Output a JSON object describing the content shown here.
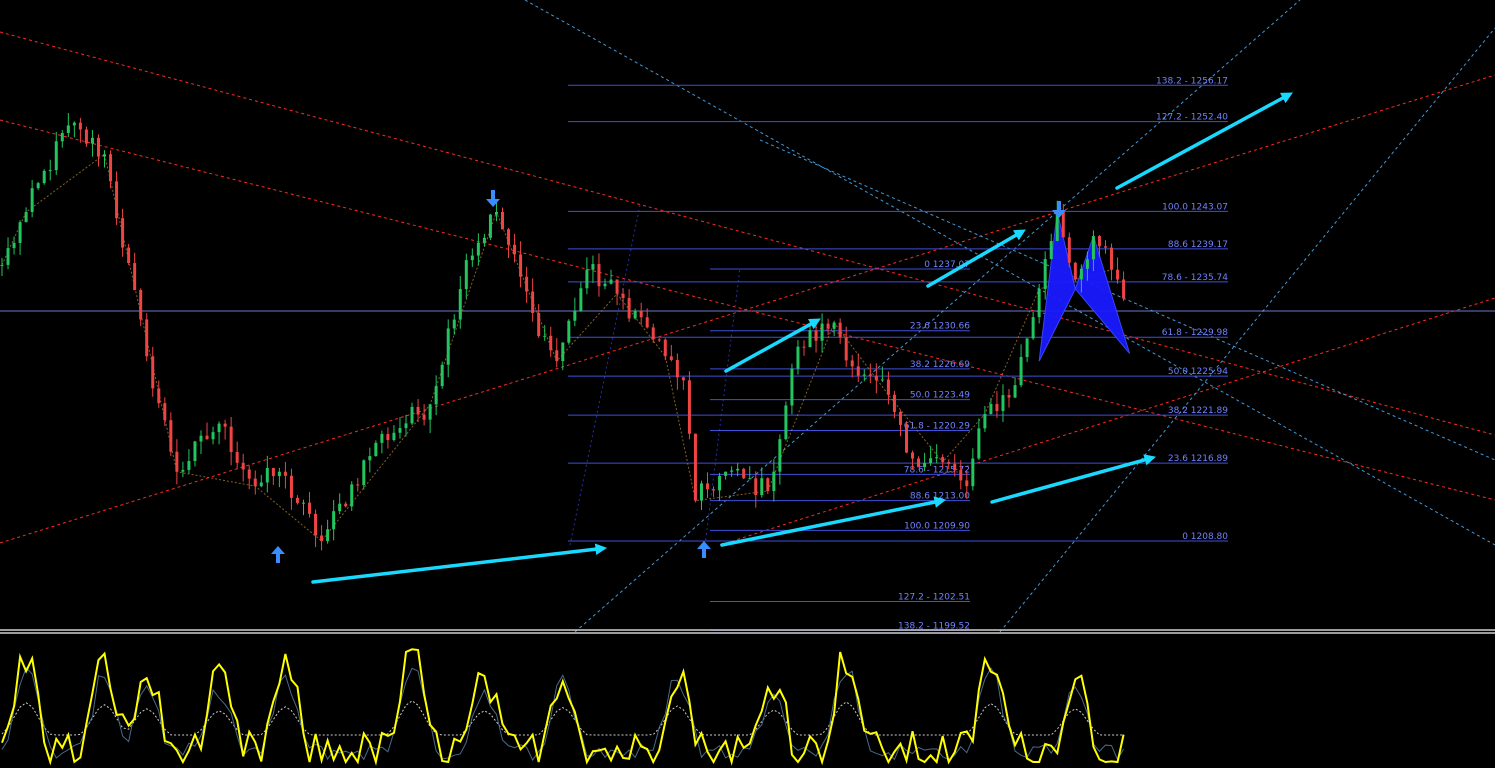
{
  "chart_data": {
    "type": "candlestick",
    "colors": {
      "background": "#000000",
      "candle_up": "#22c55e",
      "candle_down": "#ef4444",
      "fib_line": "#3f51d8",
      "fib_label": "#6f82ff",
      "channel_red": "#ff2a1f",
      "channel_cyan": "#4fb3ff",
      "arrow": "#19d9ff",
      "pattern_fill": "#1a1aff",
      "oscillator_main": "#ffff00",
      "oscillator_signal": "#ffffff",
      "marker": "#3a8dff"
    },
    "markers": [
      {
        "type": "arrow-up",
        "near_price": 1208.8
      },
      {
        "type": "arrow-up",
        "near_price": 1208.8
      },
      {
        "type": "arrow-down",
        "near_price": 1243.07
      },
      {
        "type": "arrow-down",
        "near_price": 1243.07
      }
    ],
    "fib_sets": [
      {
        "name": "right",
        "levels": [
          {
            "label": "138.2 - 1256.17",
            "price": 1256.17
          },
          {
            "label": "127.2 - 1252.40",
            "price": 1252.4
          },
          {
            "label": "100.0 1243.07",
            "price": 1243.07
          },
          {
            "label": "88.6 1239.17",
            "price": 1239.17
          },
          {
            "label": "78.6 - 1235.74",
            "price": 1235.74
          },
          {
            "label": "61.8 - 1229.98",
            "price": 1229.98
          },
          {
            "label": "50.0 1225.94",
            "price": 1225.94
          },
          {
            "label": "38.2 1221.89",
            "price": 1221.89
          },
          {
            "label": "23.6 1216.89",
            "price": 1216.89
          },
          {
            "label": "0 1208.80",
            "price": 1208.8
          }
        ]
      },
      {
        "name": "middle",
        "levels": [
          {
            "label": "0 1237.07",
            "price": 1237.07
          },
          {
            "label": "23.6 1230.66",
            "price": 1230.66
          },
          {
            "label": "38.2 1226.69",
            "price": 1226.69
          },
          {
            "label": "50.0 1223.49",
            "price": 1223.49
          },
          {
            "label": "61.8 - 1220.29",
            "price": 1220.29
          },
          {
            "label": "78.6 - 1215.72",
            "price": 1215.72
          },
          {
            "label": "88.6 1213.00",
            "price": 1213.0
          },
          {
            "label": "100.0 1209.90",
            "price": 1209.9
          },
          {
            "label": "127.2 - 1202.51",
            "price": 1202.51
          },
          {
            "label": "138.2 - 1199.52",
            "price": 1199.52
          }
        ]
      }
    ],
    "anchors": [
      {
        "bar": 0,
        "price": 1237.5
      },
      {
        "bar": 4,
        "price": 1243.0
      },
      {
        "bar": 11,
        "price": 1252.0
      },
      {
        "bar": 17,
        "price": 1249.0
      },
      {
        "bar": 24,
        "price": 1228.0
      },
      {
        "bar": 29,
        "price": 1216.0
      },
      {
        "bar": 36,
        "price": 1221.0
      },
      {
        "bar": 42,
        "price": 1214.5
      },
      {
        "bar": 46,
        "price": 1216.0
      },
      {
        "bar": 53,
        "price": 1208.8
      },
      {
        "bar": 62,
        "price": 1219.0
      },
      {
        "bar": 71,
        "price": 1223.0
      },
      {
        "bar": 77,
        "price": 1238.0
      },
      {
        "bar": 82,
        "price": 1243.0
      },
      {
        "bar": 88,
        "price": 1232.5
      },
      {
        "bar": 92,
        "price": 1227.5
      },
      {
        "bar": 97,
        "price": 1237.0
      },
      {
        "bar": 102,
        "price": 1234.5
      },
      {
        "bar": 107,
        "price": 1231.0
      },
      {
        "bar": 110,
        "price": 1228.0
      },
      {
        "bar": 113,
        "price": 1225.5
      },
      {
        "bar": 115,
        "price": 1213.0
      },
      {
        "bar": 120,
        "price": 1216.0
      },
      {
        "bar": 127,
        "price": 1214.0
      },
      {
        "bar": 132,
        "price": 1229.0
      },
      {
        "bar": 138,
        "price": 1231.5
      },
      {
        "bar": 142,
        "price": 1226.0
      },
      {
        "bar": 147,
        "price": 1224.0
      },
      {
        "bar": 150,
        "price": 1218.0
      },
      {
        "bar": 156,
        "price": 1217.0
      },
      {
        "bar": 160,
        "price": 1214.5
      },
      {
        "bar": 163,
        "price": 1222.0
      },
      {
        "bar": 168,
        "price": 1225.0
      },
      {
        "bar": 172,
        "price": 1235.0
      },
      {
        "bar": 175,
        "price": 1243.0
      },
      {
        "bar": 178,
        "price": 1236.0
      },
      {
        "bar": 181,
        "price": 1240.5
      },
      {
        "bar": 184,
        "price": 1237.0
      },
      {
        "bar": 186,
        "price": 1234.0
      }
    ],
    "oscillator": {
      "peaks": [
        {
          "bar": 4,
          "value": 0.9
        },
        {
          "bar": 17,
          "value": 0.85
        },
        {
          "bar": 24,
          "value": 0.75
        },
        {
          "bar": 36,
          "value": 0.7
        },
        {
          "bar": 47,
          "value": 0.8
        },
        {
          "bar": 68,
          "value": 0.95
        },
        {
          "bar": 80,
          "value": 0.7
        },
        {
          "bar": 93,
          "value": 0.78
        },
        {
          "bar": 112,
          "value": 0.82
        },
        {
          "bar": 128,
          "value": 0.72
        },
        {
          "bar": 140,
          "value": 0.92
        },
        {
          "bar": 164,
          "value": 0.88
        },
        {
          "bar": 178,
          "value": 0.75
        }
      ]
    }
  }
}
